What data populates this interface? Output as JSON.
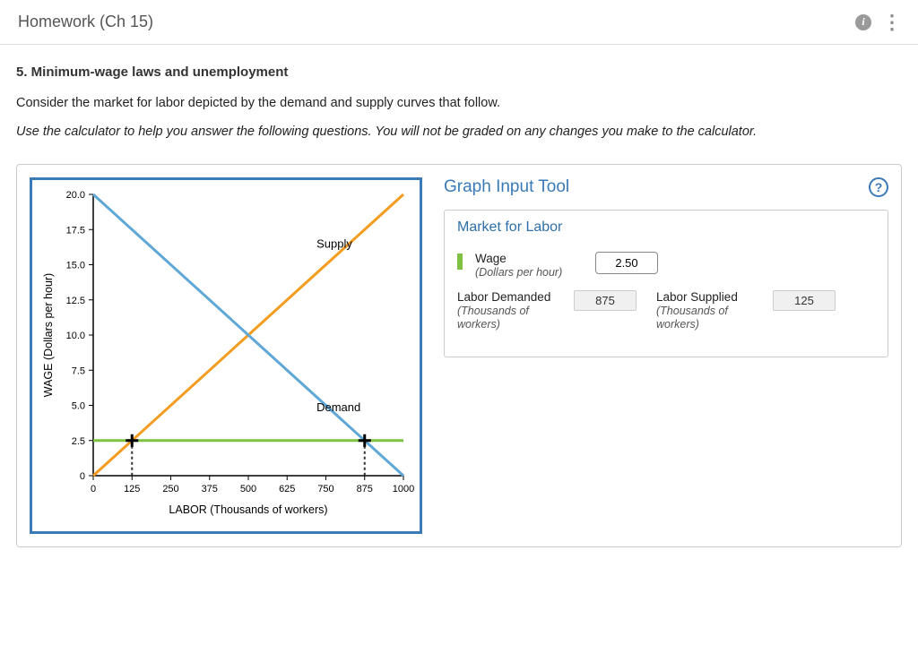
{
  "header": {
    "title": "Homework (Ch 15)"
  },
  "question": {
    "title": "5. Minimum-wage laws and unemployment",
    "desc": "Consider the market for labor depicted by the demand and supply curves that follow.",
    "instruction": "Use the calculator to help you answer the following questions. You will not be graded on any changes you make to the calculator."
  },
  "tool": {
    "title": "Graph Input Tool",
    "tab": "Market for Labor",
    "wage_label": "Wage",
    "wage_sub": "(Dollars per hour)",
    "wage_value": "2.50",
    "demanded_label": "Labor Demanded",
    "demanded_sub": "(Thousands of workers)",
    "demanded_value": "875",
    "supplied_label": "Labor Supplied",
    "supplied_sub": "(Thousands of workers)",
    "supplied_value": "125"
  },
  "chart_data": {
    "type": "line",
    "title": "",
    "xlabel": "LABOR (Thousands of workers)",
    "ylabel": "WAGE (Dollars per hour)",
    "x_ticks": [
      0,
      125,
      250,
      375,
      500,
      625,
      750,
      875,
      1000
    ],
    "y_ticks": [
      0,
      2.5,
      5.0,
      7.5,
      10.0,
      12.5,
      15.0,
      17.5,
      20.0
    ],
    "xlim": [
      0,
      1000
    ],
    "ylim": [
      0,
      20
    ],
    "series": [
      {
        "name": "Supply",
        "color": "#f39c1f",
        "points": [
          [
            0,
            0
          ],
          [
            1000,
            20
          ]
        ]
      },
      {
        "name": "Demand",
        "color": "#5ea7d6",
        "points": [
          [
            0,
            20
          ],
          [
            1000,
            0
          ]
        ]
      },
      {
        "name": "WageLine",
        "color": "#7fc241",
        "points": [
          [
            0,
            2.5
          ],
          [
            1000,
            2.5
          ]
        ]
      }
    ],
    "markers": [
      {
        "x": 125,
        "y": 2.5,
        "color": "#333"
      },
      {
        "x": 875,
        "y": 2.5,
        "color": "#333"
      }
    ],
    "annotations": {
      "supply_label": "Supply",
      "demand_label": "Demand"
    }
  }
}
